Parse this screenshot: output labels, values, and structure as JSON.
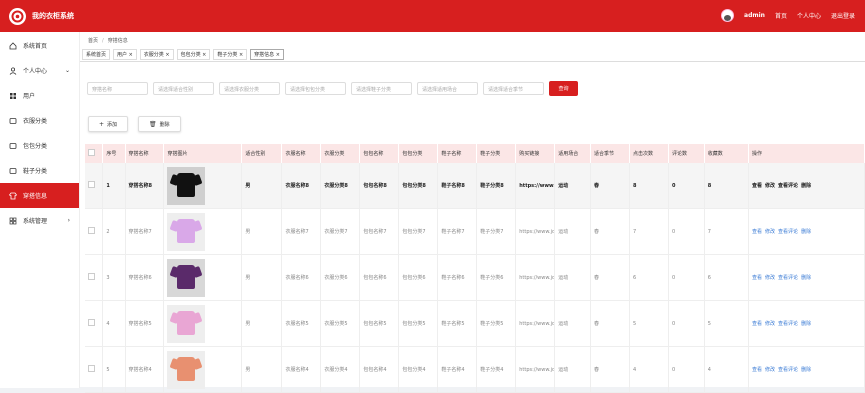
{
  "app_title": "我的衣柜系统",
  "header": {
    "username": "admin",
    "home": "首页",
    "profile": "个人中心",
    "logout": "退出登录"
  },
  "sidebar": [
    {
      "label": "系统首页",
      "icon": "home-icon"
    },
    {
      "label": "个人中心",
      "icon": "user-icon",
      "arrow": "⌄"
    },
    {
      "label": "用户",
      "icon": "grid-icon"
    },
    {
      "label": "衣服分类",
      "icon": "tag-icon"
    },
    {
      "label": "包包分类",
      "icon": "tag-icon"
    },
    {
      "label": "鞋子分类",
      "icon": "tag-icon"
    },
    {
      "label": "穿搭信息",
      "icon": "shirt-icon"
    },
    {
      "label": "系统管理",
      "icon": "settings-icon",
      "arrow": "›"
    }
  ],
  "breadcrumb": {
    "home": "首页",
    "sep": "/",
    "current": "穿搭信息"
  },
  "tabs": [
    "系统首页",
    "用户 ×",
    "衣服分类 ×",
    "包包分类 ×",
    "鞋子分类 ×",
    "穿搭信息 ×"
  ],
  "search": {
    "placeholders": [
      "穿搭名称",
      "请选择适合性别",
      "请选择衣服分类",
      "请选择包包分类",
      "请选择鞋子分类",
      "请选择适用场合",
      "请选择适合季节"
    ],
    "button": "查询"
  },
  "actions": {
    "add": "添加",
    "delete": "删除"
  },
  "table": {
    "headers": [
      "",
      "序号",
      "穿搭名称",
      "穿搭图片",
      "适合性别",
      "衣服名称",
      "衣服分类",
      "包包名称",
      "包包分类",
      "鞋子名称",
      "鞋子分类",
      "购买链接",
      "适用场合",
      "适合季节",
      "点击次数",
      "评论数",
      "收藏数",
      "操作"
    ],
    "rows": [
      {
        "idx": "1",
        "name": "穿搭名称8",
        "gender": "男",
        "cloth": "衣服名称8",
        "cloth_cat": "衣服分类8",
        "bag": "包包名称8",
        "bag_cat": "包包分类8",
        "shoe": "鞋子名称8",
        "shoe_cat": "鞋子分类8",
        "link": "https://www.jd.com/",
        "scene": "运动",
        "season": "春",
        "clicks": "8",
        "comments": "0",
        "favs": "8"
      },
      {
        "idx": "2",
        "name": "穿搭名称7",
        "gender": "男",
        "cloth": "衣服名称7",
        "cloth_cat": "衣服分类7",
        "bag": "包包名称7",
        "bag_cat": "包包分类7",
        "shoe": "鞋子名称7",
        "shoe_cat": "鞋子分类7",
        "link": "https://www.jd.com/",
        "scene": "运动",
        "season": "春",
        "clicks": "7",
        "comments": "0",
        "favs": "7"
      },
      {
        "idx": "3",
        "name": "穿搭名称6",
        "gender": "男",
        "cloth": "衣服名称6",
        "cloth_cat": "衣服分类6",
        "bag": "包包名称6",
        "bag_cat": "包包分类6",
        "shoe": "鞋子名称6",
        "shoe_cat": "鞋子分类6",
        "link": "https://www.jd.com/",
        "scene": "运动",
        "season": "春",
        "clicks": "6",
        "comments": "0",
        "favs": "6"
      },
      {
        "idx": "4",
        "name": "穿搭名称5",
        "gender": "男",
        "cloth": "衣服名称5",
        "cloth_cat": "衣服分类5",
        "bag": "包包名称5",
        "bag_cat": "包包分类5",
        "shoe": "鞋子名称5",
        "shoe_cat": "鞋子分类5",
        "link": "https://www.jd.com/",
        "scene": "运动",
        "season": "春",
        "clicks": "5",
        "comments": "0",
        "favs": "5"
      },
      {
        "idx": "5",
        "name": "穿搭名称4",
        "gender": "男",
        "cloth": "衣服名称4",
        "cloth_cat": "衣服分类4",
        "bag": "包包名称4",
        "bag_cat": "包包分类4",
        "shoe": "鞋子名称4",
        "shoe_cat": "鞋子分类4",
        "link": "https://www.jd.com/",
        "scene": "运动",
        "season": "春",
        "clicks": "4",
        "comments": "0",
        "favs": "4"
      }
    ],
    "ops": [
      "查看",
      "修改",
      "查看评论",
      "删除"
    ]
  },
  "colors": {
    "accent": "#d71f1f",
    "header_bg": "#fbe6e6",
    "link": "#3a7bd5"
  },
  "thumbs": [
    {
      "shirt": "#111111",
      "bg": "#cfcfcf"
    },
    {
      "shirt": "#d9a8e8",
      "bg": "#eeeeee"
    },
    {
      "shirt": "#5a2a6a",
      "bg": "#d8d8d8"
    },
    {
      "shirt": "#e9a6d4",
      "bg": "#eeeeee"
    },
    {
      "shirt": "#e89070",
      "bg": "#eeeeee"
    }
  ]
}
